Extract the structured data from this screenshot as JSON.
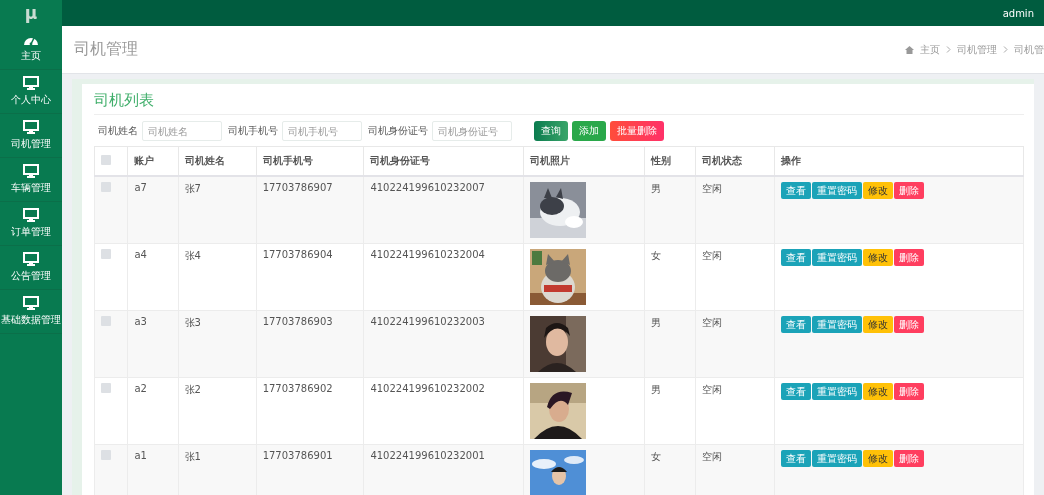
{
  "logo": "μ",
  "topbar": {
    "user": "admin"
  },
  "sidebar": {
    "items": [
      {
        "label": "主页"
      },
      {
        "label": "个人中心"
      },
      {
        "label": "司机管理"
      },
      {
        "label": "车辆管理"
      },
      {
        "label": "订单管理"
      },
      {
        "label": "公告管理"
      },
      {
        "label": "基础数据管理"
      }
    ]
  },
  "header": {
    "title": "司机管理",
    "breadcrumb": [
      "主页",
      "司机管理",
      "司机管"
    ]
  },
  "card": {
    "title": "司机列表",
    "filters": [
      {
        "label": "司机姓名",
        "placeholder": "司机姓名"
      },
      {
        "label": "司机手机号",
        "placeholder": "司机手机号"
      },
      {
        "label": "司机身份证号",
        "placeholder": "司机身份证号"
      }
    ],
    "buttons": [
      {
        "label": "查询",
        "kind": "query"
      },
      {
        "label": "添加",
        "kind": "add"
      },
      {
        "label": "批量删除",
        "kind": "danger"
      }
    ]
  },
  "table": {
    "select_all": {
      "checked": false
    },
    "columns": [
      "账户",
      "司机姓名",
      "司机手机号",
      "司机身份证号",
      "司机照片",
      "性别",
      "司机状态",
      "操作"
    ],
    "rows": [
      {
        "checked": false,
        "account": "a7",
        "name": "张7",
        "phone": "17703786907",
        "id_number": "410224199610232007",
        "photo": {
          "kind": "picture"
        },
        "gender": "男",
        "status": "空闲",
        "actions": [
          {
            "label": "查看",
            "kind": "info"
          },
          {
            "label": "重置密码",
            "kind": "info"
          },
          {
            "label": "修改",
            "kind": "warning"
          },
          {
            "label": "删除",
            "kind": "danger"
          }
        ]
      },
      {
        "checked": false,
        "account": "a4",
        "name": "张4",
        "phone": "17703786904",
        "id_number": "410224199610232004",
        "photo": {
          "kind": "picture"
        },
        "gender": "女",
        "status": "空闲",
        "actions": [
          {
            "label": "查看",
            "kind": "info"
          },
          {
            "label": "重置密码",
            "kind": "info"
          },
          {
            "label": "修改",
            "kind": "warning"
          },
          {
            "label": "删除",
            "kind": "danger"
          }
        ]
      },
      {
        "checked": false,
        "account": "a3",
        "name": "张3",
        "phone": "17703786903",
        "id_number": "410224199610232003",
        "photo": {
          "kind": "picture"
        },
        "gender": "男",
        "status": "空闲",
        "actions": [
          {
            "label": "查看",
            "kind": "info"
          },
          {
            "label": "重置密码",
            "kind": "info"
          },
          {
            "label": "修改",
            "kind": "warning"
          },
          {
            "label": "删除",
            "kind": "danger"
          }
        ]
      },
      {
        "checked": false,
        "account": "a2",
        "name": "张2",
        "phone": "17703786902",
        "id_number": "410224199610232002",
        "photo": {
          "kind": "picture"
        },
        "gender": "男",
        "status": "空闲",
        "actions": [
          {
            "label": "查看",
            "kind": "info"
          },
          {
            "label": "重置密码",
            "kind": "info"
          },
          {
            "label": "修改",
            "kind": "warning"
          },
          {
            "label": "删除",
            "kind": "danger"
          }
        ]
      },
      {
        "checked": false,
        "account": "a1",
        "name": "张1",
        "phone": "17703786901",
        "id_number": "410224199610232001",
        "photo": {
          "kind": "picture"
        },
        "gender": "女",
        "status": "空闲",
        "actions": [
          {
            "label": "查看",
            "kind": "info"
          },
          {
            "label": "重置密码",
            "kind": "info"
          },
          {
            "label": "修改",
            "kind": "warning"
          },
          {
            "label": "删除",
            "kind": "danger"
          }
        ]
      }
    ]
  }
}
